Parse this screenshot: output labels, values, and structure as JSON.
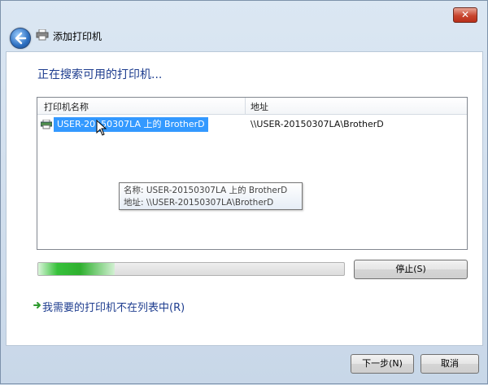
{
  "window": {
    "title": "添加打印机",
    "close_label": "✕"
  },
  "main": {
    "heading": "正在搜索可用的打印机...",
    "columns": [
      "打印机名称",
      "地址"
    ],
    "rows": [
      {
        "name": "USER-20150307LA 上的 BrotherD",
        "address": "\\\\USER-20150307LA\\BrotherD"
      }
    ],
    "tooltip": {
      "name_line": "名称: USER-20150307LA 上的 BrotherD",
      "address_line": "地址: \\\\USER-20150307LA\\BrotherD"
    },
    "progress_fraction": 0.25,
    "stop_label": "停止(S)",
    "not_listed_label": "我需要的打印机不在列表中(R)"
  },
  "footer": {
    "next_label": "下一步(N)",
    "cancel_label": "取消"
  },
  "colors": {
    "accent": "#1e3d8f",
    "selection": "#3399ff",
    "progress": "#37c13b"
  }
}
